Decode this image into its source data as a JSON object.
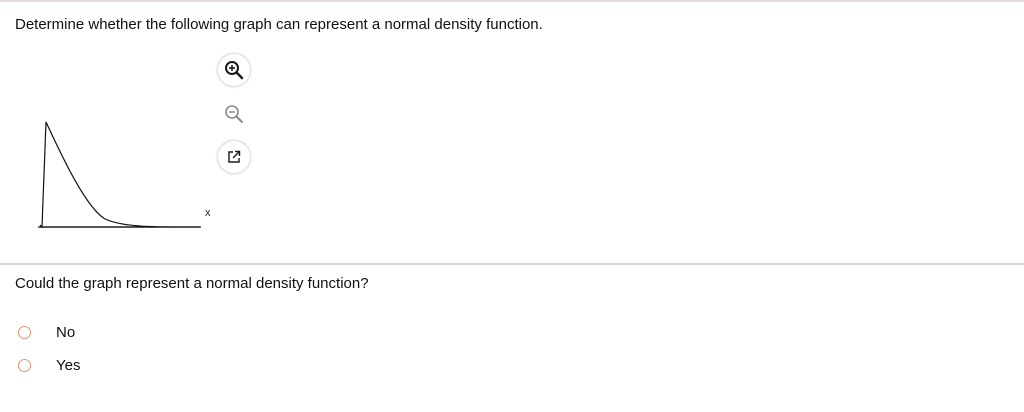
{
  "question": "Determine whether the following graph can represent a normal density function.",
  "graph": {
    "x_axis_label": "x"
  },
  "tools": {
    "zoom_in_icon": "zoom-in-icon",
    "zoom_out_icon": "zoom-out-icon",
    "popout_icon": "external-link-icon"
  },
  "sub_question": "Could the graph represent a normal density function?",
  "options": [
    {
      "label": "No",
      "selected": false
    },
    {
      "label": "Yes",
      "selected": false
    }
  ],
  "colors": {
    "radio_border": "#e0956e",
    "divider": "#e4d9d6"
  }
}
